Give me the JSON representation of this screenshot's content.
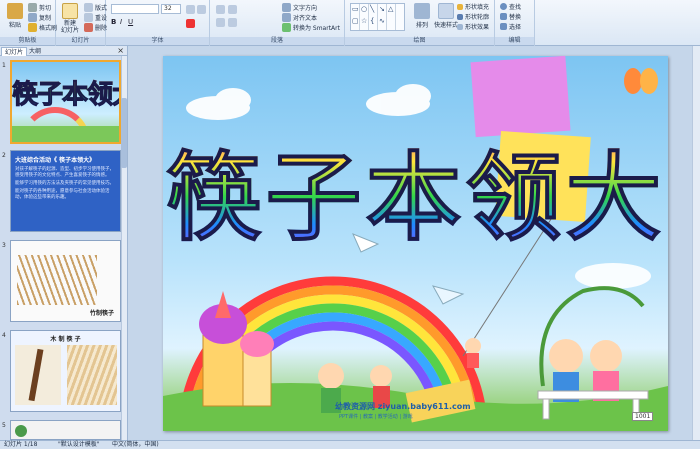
{
  "ribbon": {
    "clipboard": {
      "paste": "粘贴",
      "cut": "剪切",
      "copy": "复制",
      "format_painter": "格式刷",
      "group": "剪贴板"
    },
    "slides": {
      "new_slide": "新建\n幻灯片",
      "layout": "版式",
      "reset": "重设",
      "delete": "删除",
      "group": "幻灯片"
    },
    "font": {
      "size": "32",
      "group": "字体"
    },
    "paragraph": {
      "text_direction": "文字方向",
      "align_text": "对齐文本",
      "smartart": "转换为 SmartArt",
      "group": "段落"
    },
    "drawing": {
      "arrange": "排列",
      "quick_styles": "快速样式",
      "shape_fill": "形状填充",
      "shape_outline": "形状轮廓",
      "shape_effects": "形状效果",
      "group": "绘图"
    },
    "editing": {
      "find": "查找",
      "replace": "替换",
      "select": "选择",
      "group": "编辑"
    }
  },
  "panel": {
    "tab_slides": "幻灯片",
    "tab_outline": "大纲",
    "close": "×",
    "slides": [
      {
        "num": "1",
        "title": "筷子本领大"
      },
      {
        "num": "2",
        "heading": "大班综合活动《 筷子本领大》",
        "bullets": [
          "对孩子解筷子的起源、造型、初步学习使用筷子，感受用筷子的文化特点、产生喜爱筷子的情感。",
          "能够学习用筷的方法法及夹筷子的常见使用技巧。",
          "能对筷子的各种用途，愿意参与社会活动体验活动，体验这些带来的乐趣。"
        ]
      },
      {
        "num": "3",
        "caption": "竹制筷子"
      },
      {
        "num": "4",
        "caption": "木 制 筷 子"
      },
      {
        "num": "5"
      }
    ]
  },
  "slide": {
    "title": "筷子本领大",
    "watermark": "幼教资源网 ziyuan.baby611.com",
    "watermark_sub": "PPT课件 | 教案 | 教学活动 | 游戏",
    "sign": "1001"
  },
  "status": {
    "slide_info": "幻灯片 1/18",
    "theme": "\"默认设计模板\"",
    "language": "中文(简体，中国)"
  },
  "colors": {
    "ribbon_bg": "#dbe7f5",
    "accent": "#f0a830",
    "panel_bg": "#cfdcee"
  }
}
